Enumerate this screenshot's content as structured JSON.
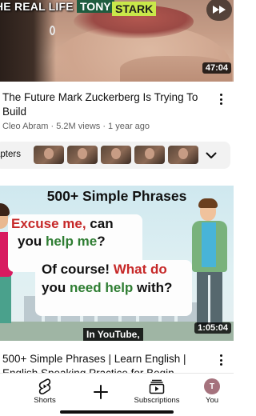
{
  "video1": {
    "caption_left": "HE REAL LIFE",
    "caption_tony": "TONY",
    "caption_stark": "STARK",
    "duration": "47:04",
    "title": "The Future Mark Zuckerberg Is Trying To Build",
    "meta": "Cleo Abram · 5.2M views · 1 year ago"
  },
  "chapters": {
    "label": "apters"
  },
  "video2": {
    "heading": "500+ Simple Phrases",
    "line1_a": "Excuse me,",
    "line1_b": " can",
    "line2_a": "you ",
    "line2_b": "help me",
    "line2_c": "?",
    "line3_a": "Of course! ",
    "line3_b": "What do",
    "line4_a": "you ",
    "line4_b": "need help",
    "line4_c": " with?",
    "subtitle": "In YouTube,",
    "duration": "1:05:04",
    "title": "500+ Simple Phrases | Learn English | English Speaking Practice for Begin..."
  },
  "nav": {
    "shorts": "Shorts",
    "subscriptions": "Subscriptions",
    "you": "You",
    "avatar_letter": "T"
  },
  "colors": {
    "accent_red": "#c62828",
    "accent_green": "#2e7d32",
    "tony_bg": "#1f5c3f",
    "stark_bg": "#c9e84a"
  }
}
